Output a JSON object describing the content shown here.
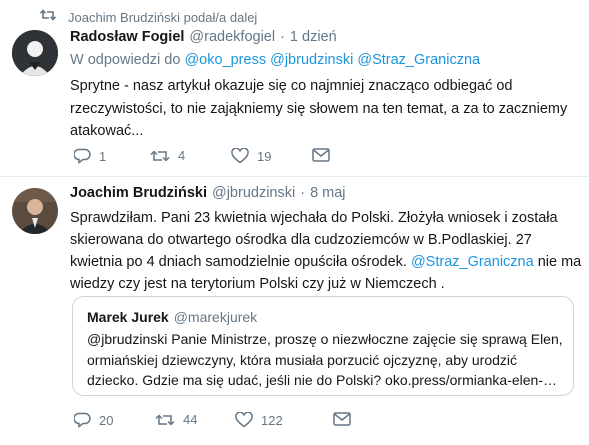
{
  "retweet_header": {
    "text": "Joachim Brudziński podał/a dalej"
  },
  "tweet1": {
    "author_name": "Radosław Fogiel",
    "author_handle": "@radekfogiel",
    "separator": "·",
    "time": "1 dzień",
    "reply_to_prefix": "W odpowiedzi do",
    "reply_to_handles": [
      "@oko_press",
      "@jbrudzinski",
      "@Straz_Graniczna"
    ],
    "text_lines": [
      "Sprytne - nasz artykuł okazuje się co najmniej znacząco odbiegać od",
      "rzeczywistości, to nie zająkniemy się słowem na ten temat, a za to zaczniemy",
      "atakować..."
    ],
    "reply_count": "1",
    "retweet_count": "4",
    "like_count": "19"
  },
  "tweet2": {
    "author_name": "Joachim Brudziński",
    "author_handle": "@jbrudzinski",
    "separator": "·",
    "time": "8 maj",
    "text_lines": [
      "Sprawdziłam. Pani 23 kwietnia wjechała do Polski. Złożyła wniosek i została",
      "skierowana do otwartego ośrodka dla cudzoziemców w B.Podlaskiej. 27",
      "kwietnia  po 4 dniach samodzielnie opuściła ośrodek."
    ],
    "mention": "@Straz_Graniczna",
    "text_after_mention": "nie ma",
    "text_last_line": "wiedzy czy jest na terytorium Polski czy już w Niemczech .",
    "quote": {
      "author_name": "Marek Jurek",
      "author_handle": "@marekjurek",
      "text_lines": [
        "@jbrudzinski Panie Ministrze, proszę o niezwłoczne zajęcie się sprawą Elen,",
        "ormiańskiej dziewczyny, która musiała porzucić ojczyznę, aby urodzić",
        "dziecko. Gdzie ma się udać, jeśli nie do Polski? oko.press/ormianka-elen-…"
      ]
    },
    "reply_count": "20",
    "retweet_count": "44",
    "like_count": "122"
  },
  "icons": {
    "retweet": "retweet-icon",
    "reply": "reply-icon",
    "like": "heart-icon",
    "dm": "envelope-icon"
  },
  "colors": {
    "link": "#1b95e0",
    "muted": "#657786",
    "text": "#14171a",
    "divider": "#e6ecf0"
  }
}
